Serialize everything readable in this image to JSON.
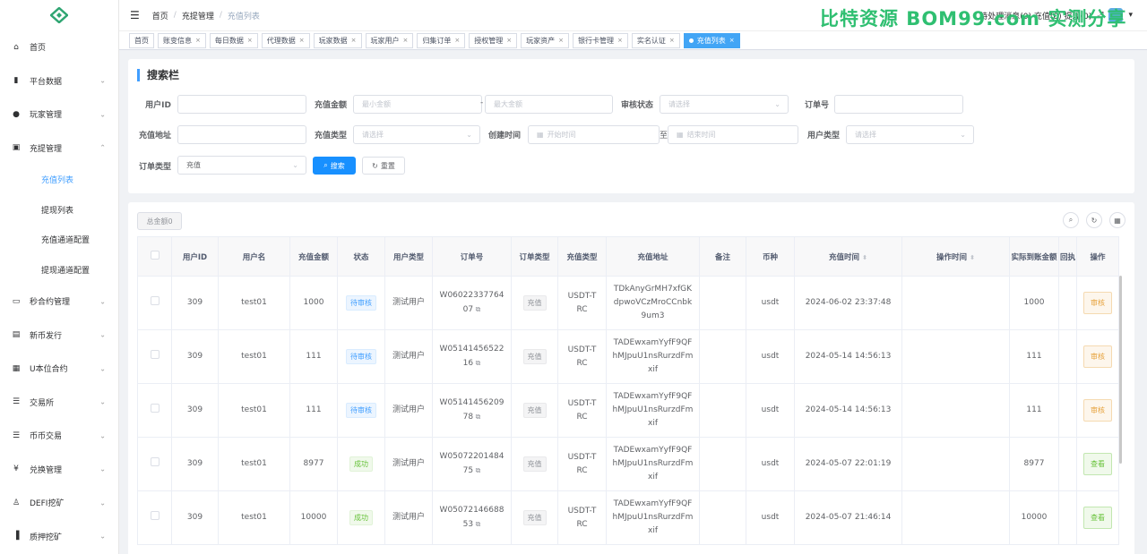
{
  "sidebar": {
    "items": [
      {
        "label": "首页",
        "icon": "dashboard-icon",
        "glyph": "⌂",
        "chevron": ""
      },
      {
        "label": "平台数据",
        "icon": "data-icon",
        "glyph": "▮",
        "chevron": "⌄"
      },
      {
        "label": "玩家管理",
        "icon": "user-icon",
        "glyph": "●",
        "chevron": "⌄"
      },
      {
        "label": "充提管理",
        "icon": "wallet-icon",
        "glyph": "▣",
        "chevron": "⌃"
      }
    ],
    "sub_items": [
      {
        "label": "充值列表",
        "active": true
      },
      {
        "label": "提现列表",
        "active": false
      },
      {
        "label": "充值通道配置",
        "active": false
      },
      {
        "label": "提现通道配置",
        "active": false
      }
    ],
    "items2": [
      {
        "label": "秒合约管理",
        "icon": "monitor-icon",
        "glyph": "▭",
        "chevron": "⌄"
      },
      {
        "label": "新币发行",
        "icon": "coin-icon",
        "glyph": "▤",
        "chevron": "⌄"
      },
      {
        "label": "U本位合约",
        "icon": "grid-icon",
        "glyph": "▦",
        "chevron": "⌄"
      },
      {
        "label": "交易所",
        "icon": "list-icon",
        "glyph": "☰",
        "chevron": "⌄"
      },
      {
        "label": "币币交易",
        "icon": "list-icon",
        "glyph": "☰",
        "chevron": "⌄"
      },
      {
        "label": "兑换管理",
        "icon": "yen-icon",
        "glyph": "¥",
        "chevron": "⌄"
      },
      {
        "label": "DEFI挖矿",
        "icon": "person-icon",
        "glyph": "♙",
        "chevron": "⌄"
      },
      {
        "label": "质押挖矿",
        "icon": "bar-chart-icon",
        "glyph": "▐",
        "chevron": "⌄"
      }
    ]
  },
  "header": {
    "breadcrumb": [
      "首页",
      "充提管理",
      "充值列表"
    ],
    "right_text": "待处理消息(0)  充值(0)  提现(0)",
    "watermark": "比特资源 BOM99.com 实测分享"
  },
  "tags": [
    {
      "label": "首页",
      "closable": false,
      "active": false
    },
    {
      "label": "账变信息",
      "closable": true,
      "active": false
    },
    {
      "label": "每日数据",
      "closable": true,
      "active": false
    },
    {
      "label": "代理数据",
      "closable": true,
      "active": false
    },
    {
      "label": "玩家数据",
      "closable": true,
      "active": false
    },
    {
      "label": "玩家用户",
      "closable": true,
      "active": false
    },
    {
      "label": "归集订单",
      "closable": true,
      "active": false
    },
    {
      "label": "授权管理",
      "closable": true,
      "active": false
    },
    {
      "label": "玩家资产",
      "closable": true,
      "active": false
    },
    {
      "label": "银行卡管理",
      "closable": true,
      "active": false
    },
    {
      "label": "实名认证",
      "closable": true,
      "active": false
    },
    {
      "label": "充值列表",
      "closable": true,
      "active": true
    }
  ],
  "search": {
    "title": "搜索栏",
    "user_id_label": "用户ID",
    "amount_label": "充值金额",
    "min_amount_placeholder": "最小金额",
    "amount_sep": "-",
    "max_amount_placeholder": "最大金额",
    "audit_status_label": "审核状态",
    "audit_status_placeholder": "请选择",
    "order_no_label": "订单号",
    "address_label": "充值地址",
    "type_label": "充值类型",
    "type_placeholder": "请选择",
    "created_label": "创建时间",
    "start_placeholder": "开始时间",
    "date_sep": "至",
    "end_placeholder": "结束时间",
    "user_type_label": "用户类型",
    "user_type_placeholder": "请选择",
    "order_type_label": "订单类型",
    "order_type_value": "充值",
    "search_btn": "搜索",
    "reset_btn": "重置"
  },
  "table": {
    "total_btn": "总金额0",
    "columns": [
      "用户ID",
      "用户名",
      "充值金额",
      "状态",
      "用户类型",
      "订单号",
      "订单类型",
      "充值类型",
      "充值地址",
      "备注",
      "币种",
      "充值时间",
      "操作时间",
      "实际到账金额",
      "回执",
      "操作"
    ],
    "rows": [
      {
        "user_id": "309",
        "username": "test01",
        "amount": "1000",
        "status": "待审核",
        "status_type": "pending",
        "user_type": "测试用户",
        "order_no": "W0602233776407",
        "order_type": "充值",
        "recharge_type": "USDT-TRC",
        "address": "TDkAnyGrMH7xfGKdpwoVCzMroCCnbk9um3",
        "remark": "",
        "currency": "usdt",
        "time": "2024-06-02 23:37:48",
        "op_time": "",
        "actual": "1000",
        "action": "审核",
        "action_type": "audit"
      },
      {
        "user_id": "309",
        "username": "test01",
        "amount": "111",
        "status": "待审核",
        "status_type": "pending",
        "user_type": "测试用户",
        "order_no": "W0514145652216",
        "order_type": "充值",
        "recharge_type": "USDT-TRC",
        "address": "TADEwxamYyfF9QFhMJpuU1nsRurzdFmxif",
        "remark": "",
        "currency": "usdt",
        "time": "2024-05-14 14:56:13",
        "op_time": "",
        "actual": "111",
        "action": "审核",
        "action_type": "audit"
      },
      {
        "user_id": "309",
        "username": "test01",
        "amount": "111",
        "status": "待审核",
        "status_type": "pending",
        "user_type": "测试用户",
        "order_no": "W0514145620978",
        "order_type": "充值",
        "recharge_type": "USDT-TRC",
        "address": "TADEwxamYyfF9QFhMJpuU1nsRurzdFmxif",
        "remark": "",
        "currency": "usdt",
        "time": "2024-05-14 14:56:13",
        "op_time": "",
        "actual": "111",
        "action": "审核",
        "action_type": "audit"
      },
      {
        "user_id": "309",
        "username": "test01",
        "amount": "8977",
        "status": "成功",
        "status_type": "success",
        "user_type": "测试用户",
        "order_no": "W0507220148475",
        "order_type": "充值",
        "recharge_type": "USDT-TRC",
        "address": "TADEwxamYyfF9QFhMJpuU1nsRurzdFmxif",
        "remark": "",
        "currency": "usdt",
        "time": "2024-05-07 22:01:19",
        "op_time": "",
        "actual": "8977",
        "action": "查看",
        "action_type": "view"
      },
      {
        "user_id": "309",
        "username": "test01",
        "amount": "10000",
        "status": "成功",
        "status_type": "success",
        "user_type": "测试用户",
        "order_no": "W0507214668853",
        "order_type": "充值",
        "recharge_type": "USDT-TRC",
        "address": "TADEwxamYyfF9QFhMJpuU1nsRurzdFmxif",
        "remark": "",
        "currency": "usdt",
        "time": "2024-05-07 21:46:14",
        "op_time": "",
        "actual": "10000",
        "action": "查看",
        "action_type": "view"
      }
    ]
  }
}
